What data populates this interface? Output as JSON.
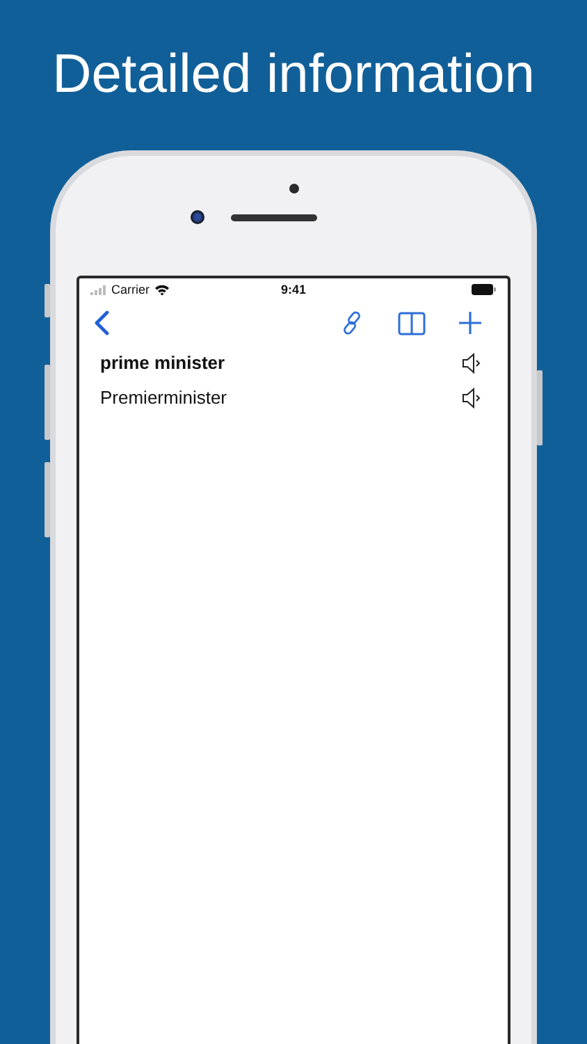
{
  "headline": "Detailed information",
  "status_bar": {
    "carrier": "Carrier",
    "time": "9:41"
  },
  "entries": [
    {
      "text": "prime minister",
      "bold": true
    },
    {
      "text": "Premierminister",
      "bold": false
    }
  ]
}
